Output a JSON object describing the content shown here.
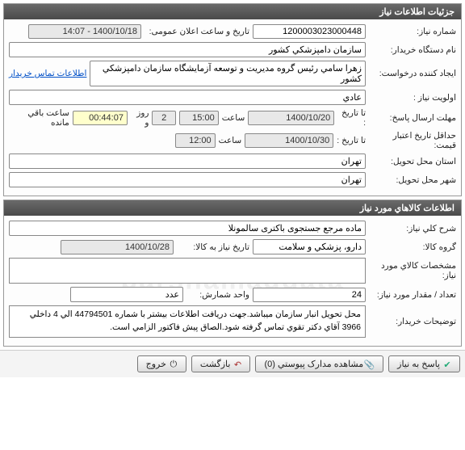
{
  "panel1": {
    "title": "جزئیات اطلاعات نیاز",
    "rows": {
      "need_no_label": "شماره نیاز:",
      "need_no": "1200003023000448",
      "announce_label": "تاریخ و ساعت اعلان عمومی:",
      "announce_value": "1400/10/18 - 14:07",
      "buyer_org_label": "نام دستگاه خریدار:",
      "buyer_org": "سازمان دامپزشکي کشور",
      "creator_label": "ایجاد کننده درخواست:",
      "creator": "زهرا سامي  رئیس گروه مدیریت و توسعه آزمایشگاه سازمان دامپزشکي کشور",
      "contact_link": "اطلاعات تماس خریدار",
      "priority_label": "اولویت نیاز :",
      "priority": "عادي",
      "deadline_label": "مهلت ارسال پاسخ:",
      "to_date_label": "تا تاریخ :",
      "deadline_date": "1400/10/20",
      "time_label": "ساعت",
      "deadline_time": "15:00",
      "days_remaining": "2",
      "days_remaining_label": "روز و",
      "time_remaining": "00:44:07",
      "time_remaining_label": "ساعت باقي مانده",
      "price_validity_label": "حداقل تاریخ اعتبار قیمت:",
      "price_validity_date": "1400/10/30",
      "price_validity_time": "12:00",
      "delivery_province_label": "استان محل تحویل:",
      "delivery_province": "تهران",
      "delivery_city_label": "شهر محل تحویل:",
      "delivery_city": "تهران"
    }
  },
  "panel2": {
    "title": "اطلاعات کالاهاي مورد نیاز",
    "rows": {
      "need_desc_label": "شرح کلي نیاز:",
      "need_desc": "ماده مرجع جستجوی باکتری سالمونلا",
      "goods_group_label": "گروه کالا:",
      "goods_group": "دارو، پزشکي و سلامت",
      "need_by_date_label": "تاریخ نیاز به کالا:",
      "need_by_date": "1400/10/28",
      "spec_label": "مشخصات کالاي مورد نیاز:",
      "spec": "",
      "qty_label": "تعداد / مقدار مورد نیاز:",
      "qty": "24",
      "unit_label": "واحد شمارش:",
      "unit": "عدد",
      "buyer_notes_label": "توضیحات خریدار:",
      "buyer_notes": "محل تحویل انبار سازمان میباشد.جهت دریافت اطلاعات بیشتر با شماره 44794501 الي 4 داخلي 3966 آقاي دکتر تقوي تماس گرفته شود.الصاق پیش فاکتور الزامي است."
    }
  },
  "buttons": {
    "reply": "پاسخ به نیاز",
    "attachments": "مشاهده مدارک پیوستي (0)",
    "back": "بازگشت",
    "exit": "خروج"
  },
  "watermark": "parsnamaddata"
}
